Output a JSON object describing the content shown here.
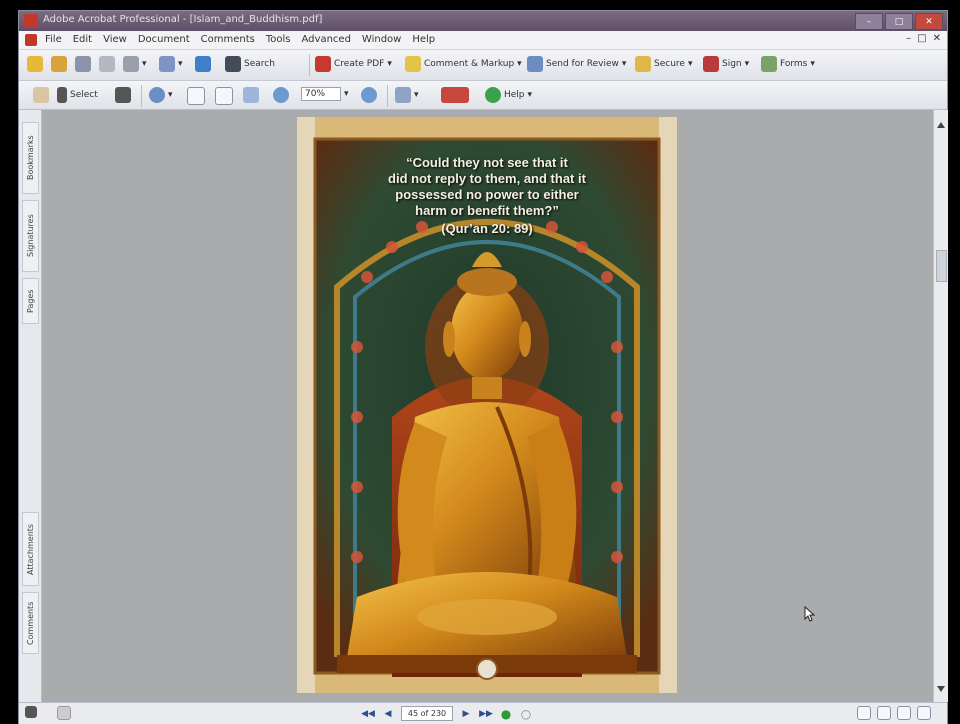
{
  "window": {
    "title": "Adobe Acrobat Professional - [Islam_and_Buddhism.pdf]"
  },
  "menubar": {
    "items": [
      "File",
      "Edit",
      "View",
      "Document",
      "Comments",
      "Tools",
      "Advanced",
      "Window",
      "Help"
    ]
  },
  "toolbar1": {
    "search_label": "Search",
    "create_pdf_label": "Create PDF",
    "comment_label": "Comment & Markup",
    "send_review_label": "Send for Review",
    "secure_label": "Secure",
    "sign_label": "Sign",
    "forms_label": "Forms"
  },
  "toolbar2": {
    "select_label": "Select",
    "zoom_value": "70%",
    "help_label": "Help"
  },
  "left_panel": {
    "tabs": [
      "Bookmarks",
      "Signatures",
      "Pages",
      "Attachments",
      "Comments"
    ]
  },
  "document": {
    "quote_lines": [
      "“Could they not see that it",
      "did not reply to them, and that it",
      "possessed no power to either",
      "harm or benefit them?”"
    ],
    "citation": "(Qur’an 20: 89)"
  },
  "statusbar": {
    "page_indicator": "45 of 230"
  },
  "colors": {
    "title_bar": "#6b5a74",
    "workspace": "#a9abad",
    "frame_gold": "#d9b878",
    "statue_gold": "#d99a2a"
  }
}
